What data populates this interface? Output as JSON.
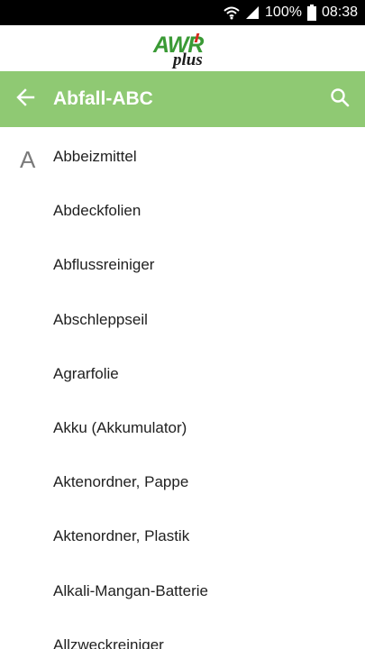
{
  "statusbar": {
    "battery": "100%",
    "time": "08:38"
  },
  "logo": {
    "main": "AWR",
    "sub": "plus"
  },
  "toolbar": {
    "title": "Abfall-ABC"
  },
  "section_letter": "A",
  "items": [
    "Abbeizmittel",
    "Abdeckfolien",
    "Abflussreiniger",
    "Abschleppseil",
    "Agrarfolie",
    "Akku (Akkumulator)",
    "Aktenordner, Pappe",
    "Aktenordner, Plastik",
    "Alkali-Mangan-Batterie",
    "Allzweckreiniger"
  ],
  "colors": {
    "toolbar": "#8fc973",
    "logo_green": "#3a9a35",
    "logo_red": "#d62a1d"
  },
  "icons": {
    "back": "arrow-left-icon",
    "search": "search-icon",
    "wifi": "wifi-icon",
    "signal": "signal-icon",
    "battery": "battery-icon"
  }
}
